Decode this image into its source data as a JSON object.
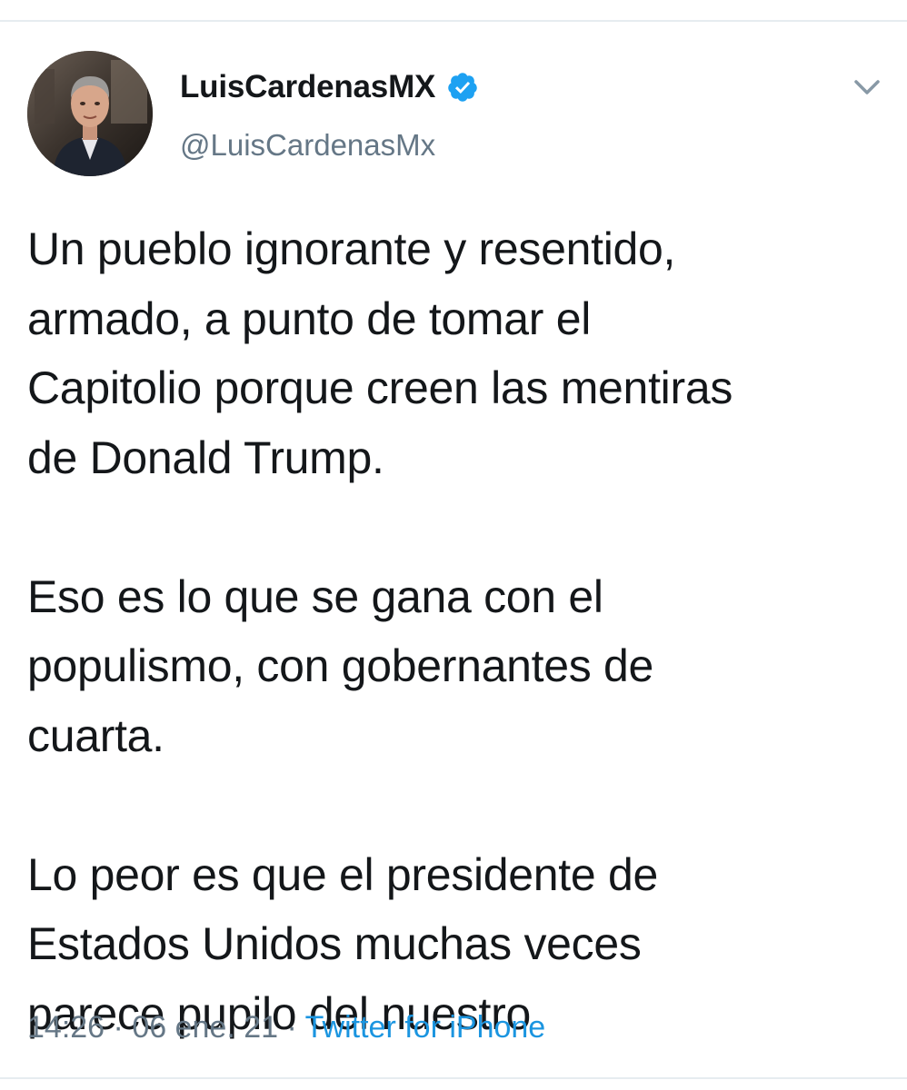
{
  "author": {
    "display_name": "LuisCardenasMX",
    "handle": "@LuisCardenasMx",
    "verified": true,
    "avatar_icon": "profile-photo"
  },
  "tweet": {
    "paragraphs": [
      "Un pueblo ignorante y resentido,\narmado, a punto de tomar el\nCapitolio porque creen las mentiras\nde Donald Trump.",
      "Eso es lo que se gana con el\npopulismo, con gobernantes de\ncuarta.",
      "Lo peor es que el presidente de\nEstados Unidos muchas veces\nparece pupilo del nuestro"
    ]
  },
  "meta": {
    "time": "14:26",
    "date": "06 ene. 21",
    "separator": "·",
    "source": "Twitter for iPhone"
  },
  "icons": {
    "verified": "verified-badge-icon",
    "menu": "chevron-down-icon"
  },
  "colors": {
    "text": "#14171a",
    "secondary": "#657786",
    "accent": "#1b95e0",
    "verified": "#1da1f2",
    "divider": "#e6ecf0"
  }
}
